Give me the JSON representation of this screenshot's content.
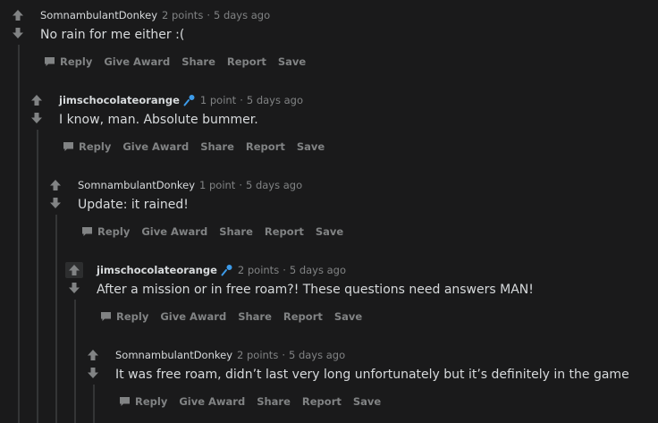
{
  "comments": [
    {
      "author": "SomnambulantDonkey",
      "points": "2 points",
      "time": "5 days ago",
      "body": "No rain for me either :(",
      "has_flair": false,
      "flair_icon": "microphone-icon"
    },
    {
      "author": "jimschocolateorange",
      "points": "1 point",
      "time": "5 days ago",
      "body": "I know, man. Absolute bummer.",
      "has_flair": true,
      "flair_icon": "microphone-icon"
    },
    {
      "author": "SomnambulantDonkey",
      "points": "1 point",
      "time": "5 days ago",
      "body": "Update: it rained!",
      "has_flair": false,
      "flair_icon": "microphone-icon"
    },
    {
      "author": "jimschocolateorange",
      "points": "2 points",
      "time": "5 days ago",
      "body": "After a mission or in free roam?! These questions need answers MAN!",
      "has_flair": true,
      "flair_icon": "microphone-icon"
    },
    {
      "author": "SomnambulantDonkey",
      "points": "2 points",
      "time": "5 days ago",
      "body": "It was free roam, didn’t last very long unfortunately but it’s definitely in the game",
      "has_flair": false,
      "flair_icon": "microphone-icon"
    }
  ],
  "actions": {
    "reply": "Reply",
    "give_award": "Give Award",
    "share": "Share",
    "report": "Report",
    "save": "Save"
  },
  "separator": "·",
  "icons": {
    "upvote": "upvote-arrow-icon",
    "downvote": "downvote-arrow-icon",
    "reply": "speech-bubble-icon",
    "flair": "microphone-icon"
  },
  "colors": {
    "background": "#1a1a1b",
    "text": "#d7dadc",
    "meta": "#818384",
    "thread_line": "#343536",
    "flair_blue": "#3d9be9"
  }
}
